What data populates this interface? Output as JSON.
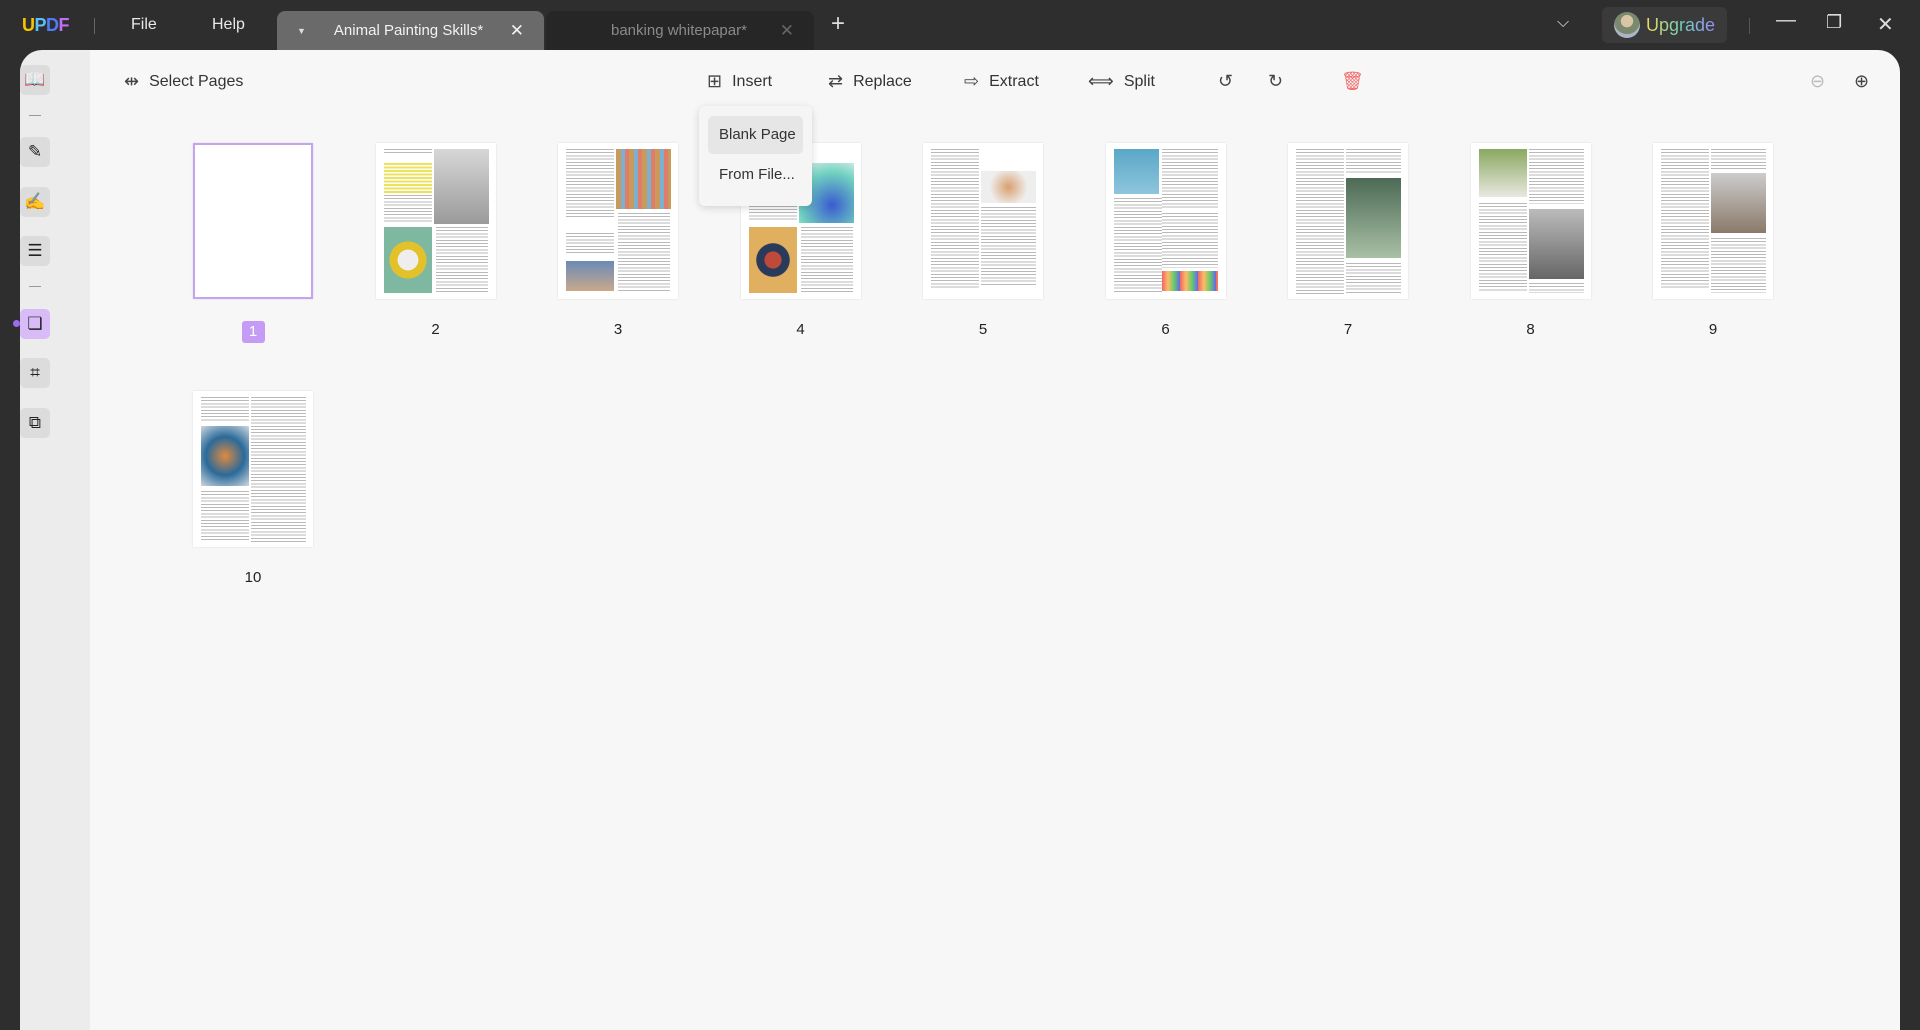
{
  "app": {
    "logo": [
      "U",
      "P",
      "D",
      "F"
    ],
    "menu": [
      "File",
      "Help"
    ]
  },
  "tabs": [
    {
      "label": "Animal Painting Skills*",
      "active": true
    },
    {
      "label": "banking whitepapar*",
      "active": false
    }
  ],
  "account": {
    "upgrade_label": "Upgrade"
  },
  "toolbar": {
    "select_pages": "Select Pages",
    "insert": "Insert",
    "replace": "Replace",
    "extract": "Extract",
    "split": "Split"
  },
  "insert_menu": {
    "items": [
      "Blank Page",
      "From File..."
    ],
    "highlighted": "Blank Page"
  },
  "pages": [
    {
      "number": "1",
      "selected": true
    },
    {
      "number": "2"
    },
    {
      "number": "3"
    },
    {
      "number": "4"
    },
    {
      "number": "5"
    },
    {
      "number": "6"
    },
    {
      "number": "7"
    },
    {
      "number": "8"
    },
    {
      "number": "9"
    },
    {
      "number": "10"
    }
  ],
  "colors": {
    "accent": "#c49bf5",
    "delete": "#f06a6a",
    "titlebar": "#2e2e2e"
  }
}
